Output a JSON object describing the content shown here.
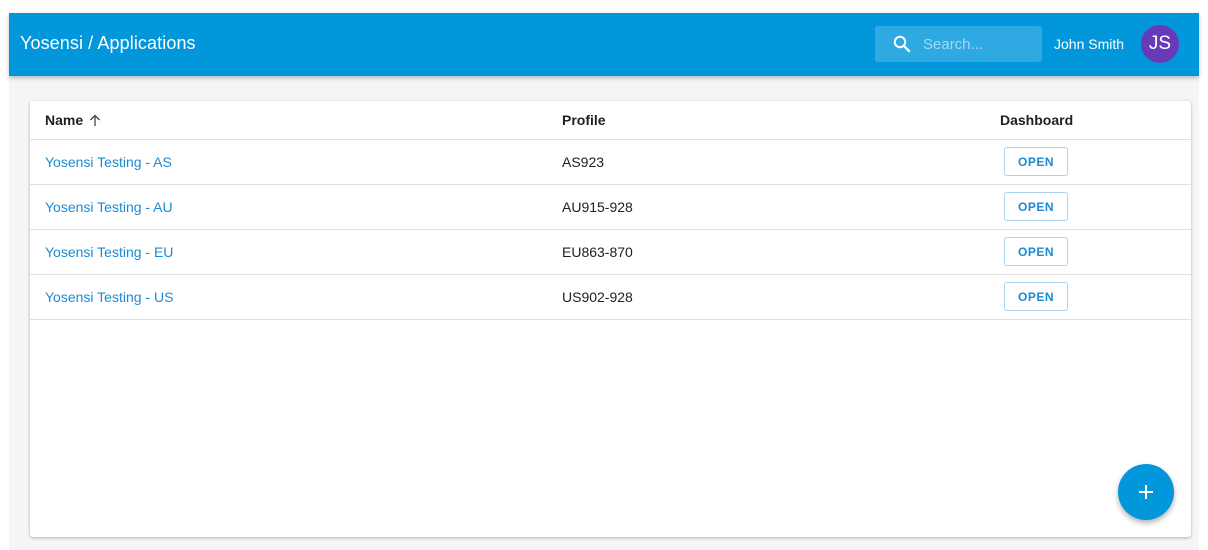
{
  "header": {
    "title": "Yosensi / Applications",
    "search_placeholder": "Search...",
    "user_name": "John Smith",
    "avatar_initials": "JS"
  },
  "table": {
    "columns": [
      "Name",
      "Profile",
      "Dashboard"
    ],
    "sort": {
      "column": "Name",
      "direction": "ascending"
    },
    "rows": [
      {
        "name": "Yosensi Testing - AS",
        "profile": "AS923",
        "action": "OPEN"
      },
      {
        "name": "Yosensi Testing - AU",
        "profile": "AU915-928",
        "action": "OPEN"
      },
      {
        "name": "Yosensi Testing - EU",
        "profile": "EU863-870",
        "action": "OPEN"
      },
      {
        "name": "Yosensi Testing - US",
        "profile": "US902-928",
        "action": "OPEN"
      }
    ]
  },
  "fab": {
    "icon": "plus-icon"
  },
  "colors": {
    "appbar": "#0296db",
    "link": "#1a8bd3",
    "avatar": "#673ab7"
  }
}
